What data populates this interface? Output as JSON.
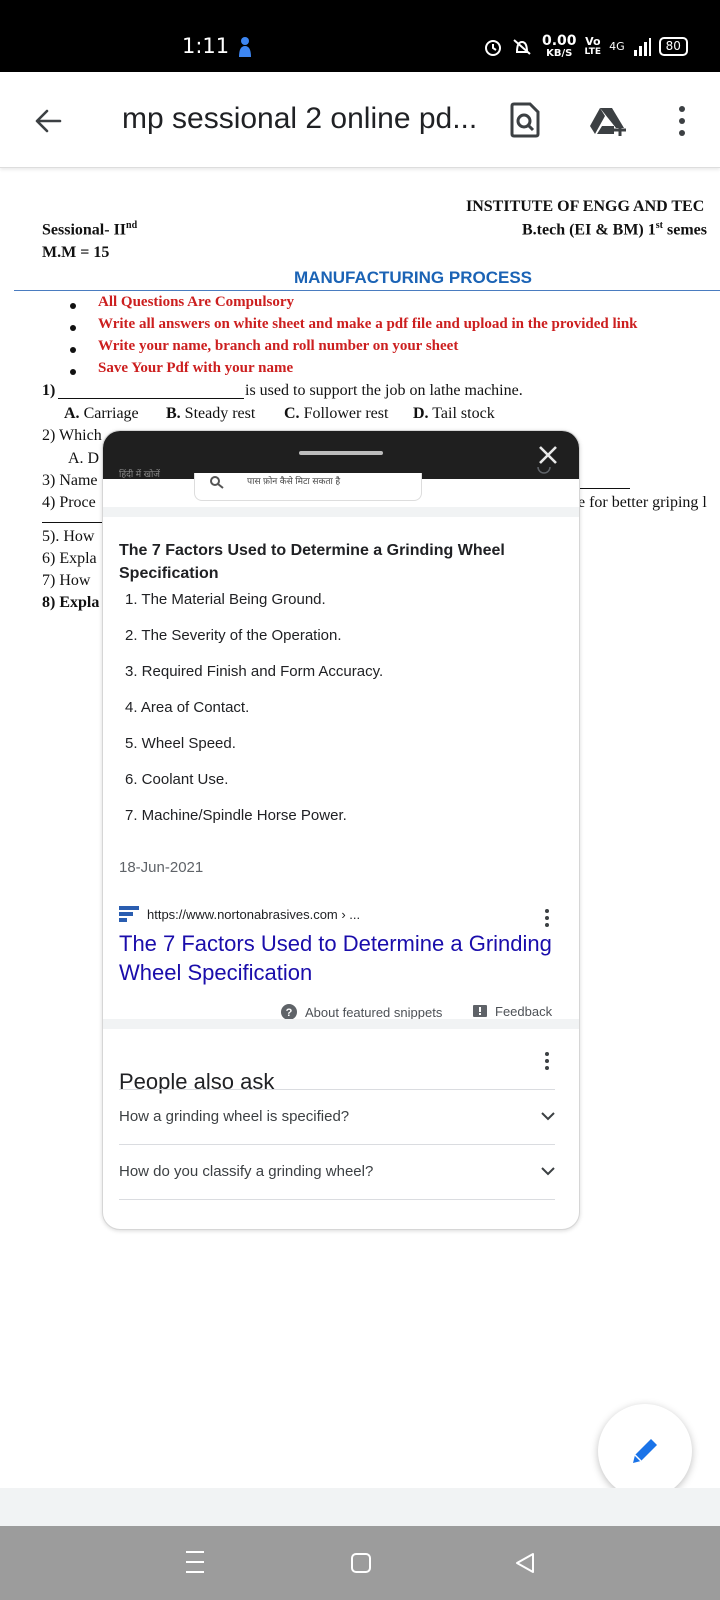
{
  "status_bar": {
    "time": "1:11",
    "net_speed_value": "0.00",
    "net_speed_unit": "KB/S",
    "volte_top": "Vo",
    "volte_bottom": "LTE",
    "network": "4G",
    "battery": "80"
  },
  "app_bar": {
    "title": "mp sessional 2 online pd...",
    "icons": [
      "back-arrow-icon",
      "find-in-page-icon",
      "add-to-drive-icon",
      "more-vert-icon"
    ]
  },
  "pdf": {
    "institute": "INSTITUTE OF ENGG AND TEC",
    "sessional": "Sessional- II",
    "sessional_sup": "nd",
    "course_line_a": "B.tech (EI & BM) 1",
    "course_line_sup": "st",
    "course_line_b": " semes",
    "marks": "M.M =  15",
    "subject": "MANUFACTURING PROCESS",
    "instructions": [
      "All Questions Are Compulsory",
      "Write all answers on white sheet and make a pdf file and upload in  the provided link",
      "Write your name, branch and roll number on your sheet",
      "Save Your Pdf with your name"
    ],
    "q1_num": "1)",
    "q1_text": "is used to support the job on lathe machine.",
    "q1_opt_a_letter": "A.",
    "q1_opt_a": " Carriage",
    "q1_opt_b_letter": "B.",
    "q1_opt_b": " Steady rest",
    "q1_opt_c_letter": "C.",
    "q1_opt_c": " Follower rest",
    "q1_opt_d_letter": "D.",
    "q1_opt_d": " Tail stock",
    "q2": "2) Which",
    "q2_opt": "A. D",
    "q3": "3) Name",
    "q4": "4) Proce",
    "q4_tail": "e for better griping l",
    "q5": "5). How",
    "q6": "6) Expla",
    "q7": "7) How",
    "q8": "8) Expla"
  },
  "popup": {
    "hindi_left": "हिंदी में खोजें",
    "search_hint": "पास फ़ोन कैसे मिटा सकता है",
    "snippet_title": "The 7 Factors Used to Determine a Grinding Wheel Specification",
    "factors": [
      "1. The Material Being Ground.",
      "2. The Severity of the Operation.",
      "3. Required Finish and Form Accuracy.",
      "4. Area of Contact.",
      "5. Wheel Speed.",
      "6. Coolant Use.",
      "7. Machine/Spindle Horse Power."
    ],
    "date": "18-Jun-2021",
    "source_url": "https://www.nortonabrasives.com › ...",
    "link_title": "The 7 Factors Used to Determine a Grinding Wheel Specification",
    "about_snippets": "About featured snippets",
    "feedback": "Feedback",
    "people_also_ask": "People also ask",
    "questions": [
      "How a grinding wheel is specified?",
      "How do you classify a grinding wheel?"
    ]
  },
  "nav_bar": {
    "buttons": [
      "recent-apps-icon",
      "home-icon",
      "back-icon"
    ]
  }
}
